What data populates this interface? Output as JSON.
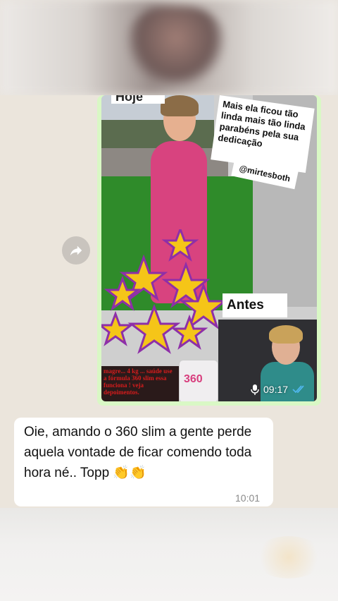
{
  "image_message": {
    "hoje_label": "Hoje",
    "caption": "Mais ela ficou tão linda mais tão linda parabéns pela sua dedicação",
    "handle": "@mirtesboth",
    "antes_label": "Antes",
    "promo_text": "magre... 4 kg ... saúde use a fórmula 360 slim essa funciona ! veja depoimentos.",
    "jar_label": "360",
    "time": "09:17"
  },
  "text_message": {
    "text": "Oie, amando o 360 slim a gente perde aquela vontade de ficar comendo toda hora né..  Topp 👏👏",
    "time": "10:01"
  },
  "icons": {
    "forward": "forward-arrow-icon",
    "microphone": "microphone-icon",
    "read_receipt": "double-check-icon"
  },
  "colors": {
    "chat_bg": "#ebe5dc",
    "outgoing_bubble": "#d9f8c5",
    "incoming_bubble": "#ffffff",
    "read_tick": "#4fb6ec"
  }
}
